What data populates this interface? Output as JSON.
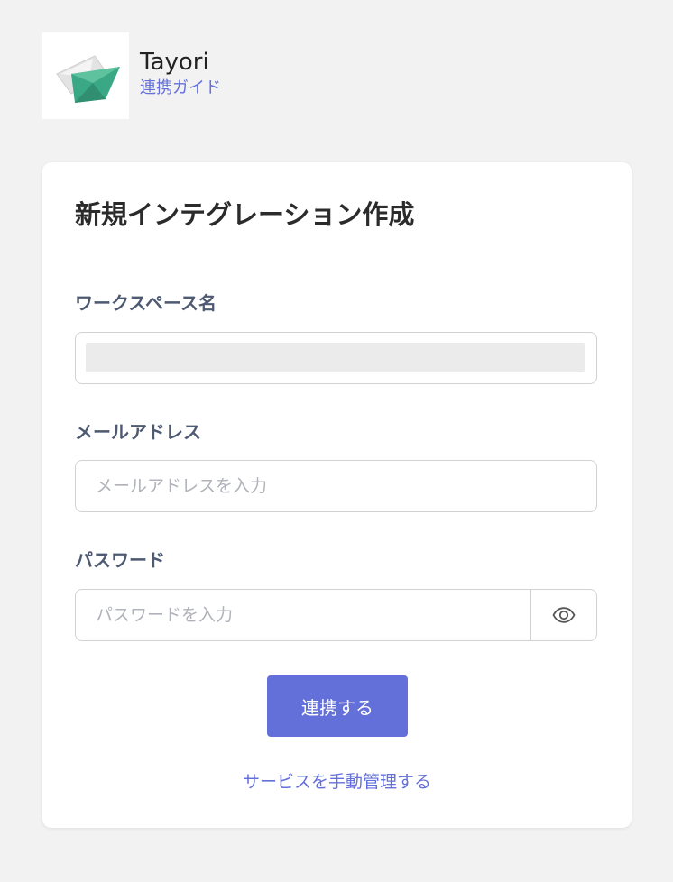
{
  "app": {
    "name": "Tayori",
    "guide_link": "連携ガイド",
    "logo_icon": "tayori-paper-plane-logo"
  },
  "form": {
    "title": "新規インテグレーション作成",
    "workspace": {
      "label": "ワークスペース名",
      "value": ""
    },
    "email": {
      "label": "メールアドレス",
      "placeholder": "メールアドレスを入力"
    },
    "password": {
      "label": "パスワード",
      "placeholder": "パスワードを入力",
      "toggle_icon": "eye-icon"
    },
    "submit_label": "連携する",
    "manual_link": "サービスを手動管理する"
  },
  "colors": {
    "accent": "#6470d9",
    "background": "#f2f2f2",
    "label": "#4d5a72",
    "logo_green": "#3aa884",
    "logo_gray": "#e0e0e0"
  }
}
